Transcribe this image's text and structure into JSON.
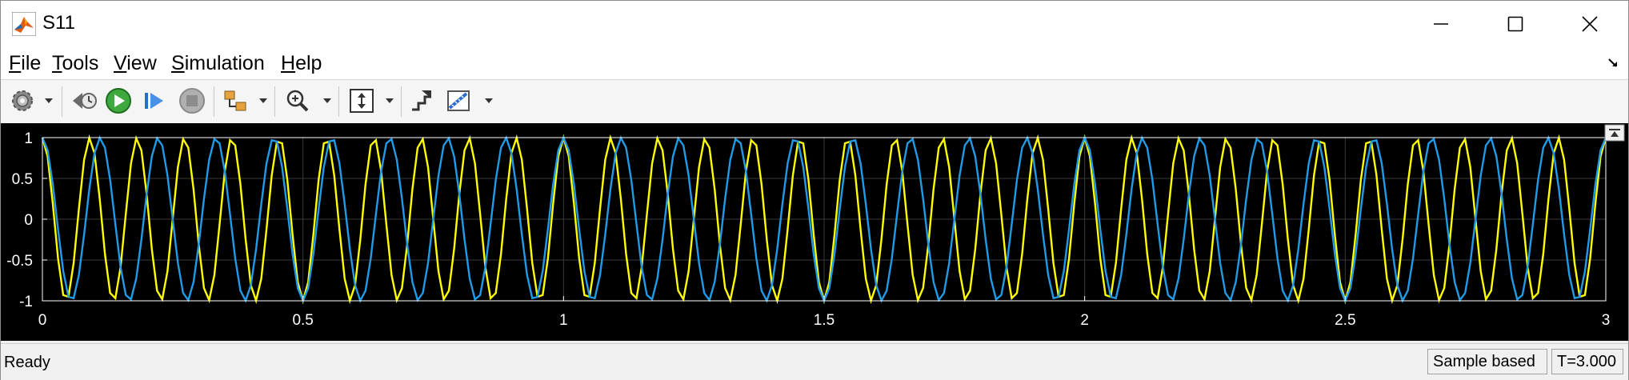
{
  "window": {
    "title": "S11"
  },
  "menu": {
    "items": [
      {
        "label": "File",
        "u": "F",
        "rest": "ile"
      },
      {
        "label": "Tools",
        "u": "T",
        "rest": "ools"
      },
      {
        "label": "View",
        "u": "V",
        "rest": "iew"
      },
      {
        "label": "Simulation",
        "u": "S",
        "rest": "imulation"
      },
      {
        "label": "Help",
        "u": "H",
        "rest": "elp"
      }
    ]
  },
  "toolbar": {
    "icons": [
      "settings-gear-icon",
      "dropdown-arrow-icon",
      "step-back-icon",
      "run-icon",
      "step-forward-icon",
      "stop-icon",
      "signal-selector-icon",
      "dropdown-arrow-icon",
      "zoom-icon",
      "dropdown-arrow-icon",
      "autoscale-icon",
      "dropdown-arrow-icon",
      "highlight-block-icon",
      "measurement-icon",
      "dropdown-arrow-icon"
    ]
  },
  "colors": {
    "yellow": "#ffff00",
    "blue": "#1f9be8",
    "axes": "#ffffff",
    "grid": "#3a3a3a"
  },
  "chart_data": {
    "type": "line",
    "title": "",
    "xlabel": "",
    "ylabel": "",
    "xlim": [
      0,
      3
    ],
    "ylim": [
      -1,
      1
    ],
    "x_ticks": [
      "0",
      "0.5",
      "1",
      "1.5",
      "2",
      "2.5",
      "3"
    ],
    "y_ticks": [
      "1",
      "0.5",
      "0",
      "-0.5",
      "-1"
    ],
    "grid": true,
    "series": [
      {
        "color": "#ffff00",
        "sample_time": 0.01,
        "periods_per_second": 11,
        "amplitude": 1
      },
      {
        "color": "#1f9be8",
        "sample_time": 0.01,
        "periods_per_second": 9,
        "amplitude": 1
      }
    ]
  },
  "status": {
    "text": "Ready",
    "mode": "Sample based",
    "time": "T=3.000"
  }
}
